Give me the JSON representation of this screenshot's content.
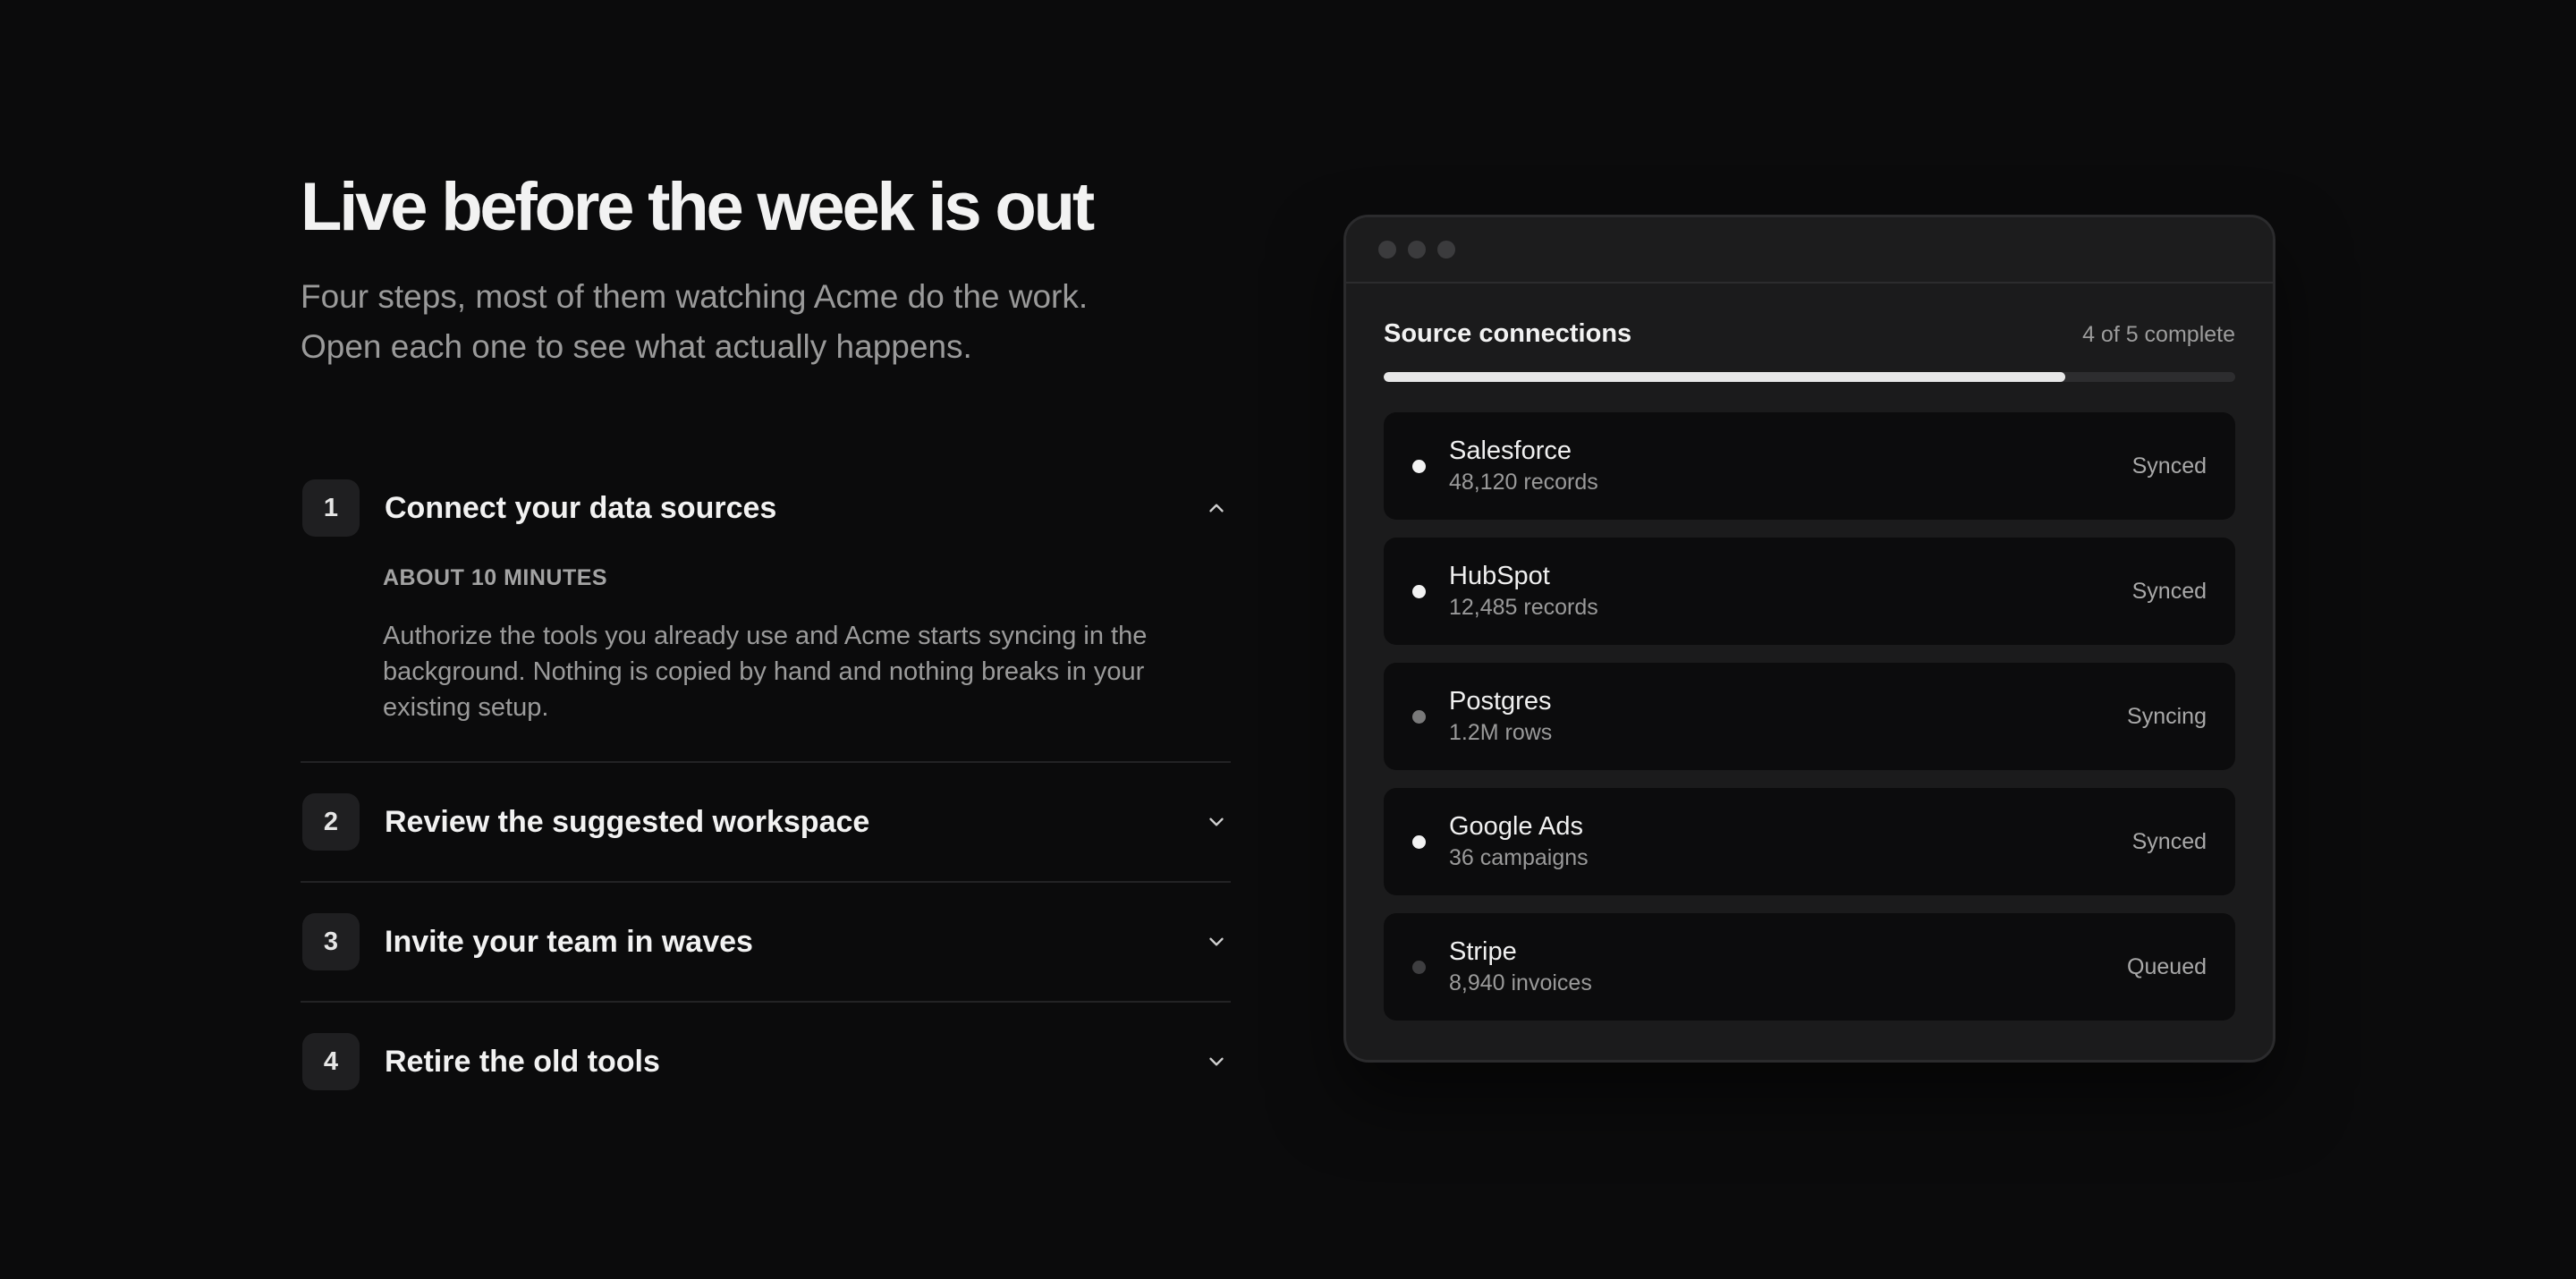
{
  "hero": {
    "title": "Live before the week is out",
    "subtitle": "Four steps, most of them watching Acme do the work. Open each one to see what actually happens."
  },
  "steps": [
    {
      "number": "1",
      "title": "Connect your data sources",
      "expanded": true,
      "chevron_icon": "chevron-up-icon",
      "duration": "ABOUT 10 MINUTES",
      "description": "Authorize the tools you already use and Acme starts syncing in the background. Nothing is copied by hand and nothing breaks in your existing setup."
    },
    {
      "number": "2",
      "title": "Review the suggested workspace",
      "expanded": false,
      "chevron_icon": "chevron-down-icon"
    },
    {
      "number": "3",
      "title": "Invite your team in waves",
      "expanded": false,
      "chevron_icon": "chevron-down-icon"
    },
    {
      "number": "4",
      "title": "Retire the old tools",
      "expanded": false,
      "chevron_icon": "chevron-down-icon"
    }
  ],
  "panel": {
    "title": "Source connections",
    "status": "4 of 5 complete",
    "progress_fraction": 0.8,
    "sources": [
      {
        "name": "Salesforce",
        "detail": "48,120 records",
        "status": "Synced",
        "dot_color": "#f2f2f2"
      },
      {
        "name": "HubSpot",
        "detail": "12,485 records",
        "status": "Synced",
        "dot_color": "#f2f2f2"
      },
      {
        "name": "Postgres",
        "detail": "1.2M rows",
        "status": "Syncing",
        "dot_color": "#7a7a7a"
      },
      {
        "name": "Google Ads",
        "detail": "36 campaigns",
        "status": "Synced",
        "dot_color": "#f2f2f2"
      },
      {
        "name": "Stripe",
        "detail": "8,940 invoices",
        "status": "Queued",
        "dot_color": "#3e3e40"
      }
    ]
  },
  "colors": {
    "background": "#0b0b0c",
    "window": "#1b1b1c",
    "card": "#0c0c0d",
    "accent": "#e7e7e7"
  }
}
